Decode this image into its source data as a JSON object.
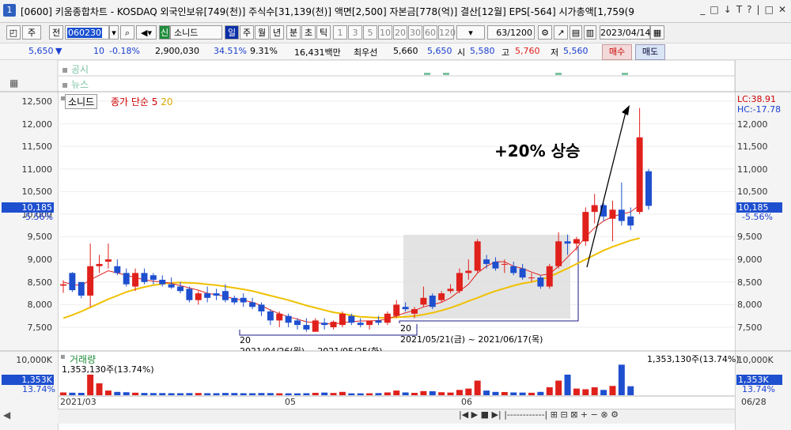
{
  "window": {
    "icon_label": "1",
    "title": "[0600] 키움종합차트 - KOSDAQ 외국인보유[749(천)] 주식수[31,139(천)] 액면[2,500] 자본금[778(억)] 결산[12월] EPS[-564] 시가총액[1,759(9",
    "controls": [
      "_",
      "□",
      "↓",
      "T",
      "?",
      "|",
      "□",
      "✕"
    ]
  },
  "toolbar": {
    "period_week": "주",
    "prev": "전",
    "code": "060230",
    "credit_tag": "신",
    "stock_name": "소니드",
    "periods": [
      "일",
      "주",
      "월",
      "년",
      "분",
      "초",
      "틱"
    ],
    "intervals": [
      "1",
      "3",
      "5",
      "10",
      "20",
      "30",
      "60",
      "120"
    ],
    "count": "63",
    "count_max": "/1200",
    "date": "2023/04/14"
  },
  "quote": {
    "price": "5,650",
    "change_sign": "▼",
    "change": "10",
    "change_pct": "-0.18%",
    "volume": "2,900,030",
    "ratio1": "34.51%",
    "ratio2": "9.31%",
    "amount": "16,431백만",
    "best_label": "최우선",
    "best_ask": "5,660",
    "best_bid": "5,650",
    "open_label": "시",
    "open": "5,580",
    "high_label": "고",
    "high": "5,760",
    "low_label": "저",
    "low": "5,560",
    "buy": "매수",
    "sell": "매도"
  },
  "panels": {
    "disclosure": "공시",
    "news": "뉴스"
  },
  "legend": {
    "name": "소니드",
    "ma_label": "종가 단순 5",
    "ma20": "20"
  },
  "annotation": {
    "text": "+20% 상승",
    "box_label1": "20",
    "box_range1": "2021/04/26(월) ~ 2021/05/25(화)",
    "box_label2": "20",
    "box_range2": "2021/05/21(금) ~ 2021/06/17(목)"
  },
  "price_axis": {
    "ticks": [
      "12,500",
      "12,000",
      "11,500",
      "11,000",
      "10,500",
      "10,000",
      "9,500",
      "9,000",
      "8,500",
      "8,000",
      "7,500"
    ],
    "current_price": "10,185",
    "current_change": "-5.56%",
    "lc": "LC:38.91",
    "hc": "HC:-17.78"
  },
  "volume_panel": {
    "label": "거래량",
    "info": "1,353,130주(13.74%)",
    "info_right": "1,353,130주(13.74%)",
    "axis_top": "10,000K",
    "current": "1,353K",
    "current_pct": "13.74%"
  },
  "x_axis": {
    "labels": [
      "2021/03",
      "05",
      "06",
      "06/28"
    ]
  },
  "colors": {
    "up": "#e0201b",
    "down": "#1e4fcf",
    "ma5": "#e0201b",
    "ma20": "#f0c000"
  },
  "chart_data": {
    "type": "candlestick",
    "title": "",
    "xlabel": "",
    "ylabel": "",
    "ylim": [
      7200,
      12700
    ],
    "candles": [
      {
        "o": 8420,
        "h": 8540,
        "l": 8260,
        "c": 8450
      },
      {
        "o": 8700,
        "h": 8720,
        "l": 8280,
        "c": 8320
      },
      {
        "o": 8500,
        "h": 8500,
        "l": 8140,
        "c": 8200
      },
      {
        "o": 8200,
        "h": 9350,
        "l": 7950,
        "c": 8850
      },
      {
        "o": 8850,
        "h": 9100,
        "l": 8700,
        "c": 8900
      },
      {
        "o": 8950,
        "h": 9350,
        "l": 8800,
        "c": 9000
      },
      {
        "o": 8850,
        "h": 9000,
        "l": 8650,
        "c": 8700
      },
      {
        "o": 8700,
        "h": 8800,
        "l": 8400,
        "c": 8450
      },
      {
        "o": 8400,
        "h": 8800,
        "l": 8300,
        "c": 8700
      },
      {
        "o": 8700,
        "h": 8800,
        "l": 8450,
        "c": 8500
      },
      {
        "o": 8650,
        "h": 8700,
        "l": 8450,
        "c": 8550
      },
      {
        "o": 8550,
        "h": 8650,
        "l": 8400,
        "c": 8450
      },
      {
        "o": 8450,
        "h": 8600,
        "l": 8350,
        "c": 8380
      },
      {
        "o": 8400,
        "h": 8500,
        "l": 8250,
        "c": 8300
      },
      {
        "o": 8350,
        "h": 8400,
        "l": 8050,
        "c": 8100
      },
      {
        "o": 8100,
        "h": 8300,
        "l": 8000,
        "c": 8250
      },
      {
        "o": 8250,
        "h": 8400,
        "l": 8050,
        "c": 8150
      },
      {
        "o": 8250,
        "h": 8350,
        "l": 8100,
        "c": 8200
      },
      {
        "o": 8300,
        "h": 8450,
        "l": 8050,
        "c": 8100
      },
      {
        "o": 8150,
        "h": 8200,
        "l": 8000,
        "c": 8050
      },
      {
        "o": 8150,
        "h": 8250,
        "l": 7950,
        "c": 8050
      },
      {
        "o": 8050,
        "h": 8150,
        "l": 7900,
        "c": 7950
      },
      {
        "o": 8000,
        "h": 8050,
        "l": 7750,
        "c": 7850
      },
      {
        "o": 7850,
        "h": 7900,
        "l": 7550,
        "c": 7650
      },
      {
        "o": 7650,
        "h": 7850,
        "l": 7500,
        "c": 7800
      },
      {
        "o": 7750,
        "h": 7800,
        "l": 7500,
        "c": 7600
      },
      {
        "o": 7650,
        "h": 7700,
        "l": 7450,
        "c": 7550
      },
      {
        "o": 7550,
        "h": 7700,
        "l": 7400,
        "c": 7450
      },
      {
        "o": 7400,
        "h": 7700,
        "l": 7400,
        "c": 7650
      },
      {
        "o": 7600,
        "h": 7700,
        "l": 7450,
        "c": 7550
      },
      {
        "o": 7500,
        "h": 7650,
        "l": 7450,
        "c": 7620
      },
      {
        "o": 7550,
        "h": 7850,
        "l": 7500,
        "c": 7800
      },
      {
        "o": 7750,
        "h": 7800,
        "l": 7550,
        "c": 7600
      },
      {
        "o": 7600,
        "h": 7700,
        "l": 7500,
        "c": 7550
      },
      {
        "o": 7550,
        "h": 7650,
        "l": 7450,
        "c": 7650
      },
      {
        "o": 7650,
        "h": 7750,
        "l": 7550,
        "c": 7600
      },
      {
        "o": 7600,
        "h": 7850,
        "l": 7550,
        "c": 7800
      },
      {
        "o": 7750,
        "h": 8100,
        "l": 7700,
        "c": 8000
      },
      {
        "o": 7950,
        "h": 8050,
        "l": 7850,
        "c": 7900
      },
      {
        "o": 7800,
        "h": 7950,
        "l": 7700,
        "c": 7900
      },
      {
        "o": 8000,
        "h": 8400,
        "l": 7950,
        "c": 8150
      },
      {
        "o": 8200,
        "h": 8250,
        "l": 7900,
        "c": 7950
      },
      {
        "o": 8100,
        "h": 8300,
        "l": 8050,
        "c": 8250
      },
      {
        "o": 8300,
        "h": 8450,
        "l": 8250,
        "c": 8350
      },
      {
        "o": 8300,
        "h": 8800,
        "l": 8250,
        "c": 8700
      },
      {
        "o": 8700,
        "h": 9000,
        "l": 8550,
        "c": 8750
      },
      {
        "o": 8750,
        "h": 9450,
        "l": 8700,
        "c": 9400
      },
      {
        "o": 9000,
        "h": 9100,
        "l": 8800,
        "c": 8900
      },
      {
        "o": 8950,
        "h": 9050,
        "l": 8750,
        "c": 8800
      },
      {
        "o": 8900,
        "h": 9000,
        "l": 8700,
        "c": 8900
      },
      {
        "o": 8850,
        "h": 8950,
        "l": 8650,
        "c": 8700
      },
      {
        "o": 8800,
        "h": 8900,
        "l": 8550,
        "c": 8600
      },
      {
        "o": 8600,
        "h": 8700,
        "l": 8500,
        "c": 8600
      },
      {
        "o": 8600,
        "h": 8650,
        "l": 8350,
        "c": 8400
      },
      {
        "o": 8400,
        "h": 8900,
        "l": 8350,
        "c": 8850
      },
      {
        "o": 8850,
        "h": 9600,
        "l": 8800,
        "c": 9400
      },
      {
        "o": 9400,
        "h": 9550,
        "l": 9100,
        "c": 9350
      },
      {
        "o": 9350,
        "h": 9500,
        "l": 9200,
        "c": 9450
      },
      {
        "o": 9400,
        "h": 10150,
        "l": 9300,
        "c": 10050
      },
      {
        "o": 10050,
        "h": 10450,
        "l": 9800,
        "c": 10200
      },
      {
        "o": 10200,
        "h": 10250,
        "l": 9850,
        "c": 9950
      },
      {
        "o": 9900,
        "h": 10300,
        "l": 9400,
        "c": 10100
      },
      {
        "o": 10100,
        "h": 10700,
        "l": 9750,
        "c": 9850
      },
      {
        "o": 9950,
        "h": 10150,
        "l": 9650,
        "c": 9750
      },
      {
        "o": 10050,
        "h": 12350,
        "l": 10000,
        "c": 11700
      },
      {
        "o": 10950,
        "h": 11000,
        "l": 10100,
        "c": 10185
      }
    ],
    "volume": [
      420,
      380,
      360,
      3100,
      1800,
      700,
      500,
      450,
      380,
      340,
      320,
      320,
      300,
      300,
      320,
      330,
      300,
      300,
      340,
      330,
      300,
      300,
      330,
      320,
      290,
      280,
      280,
      300,
      360,
      400,
      340,
      500,
      280,
      280,
      290,
      320,
      420,
      700,
      420,
      360,
      620,
      600,
      450,
      400,
      800,
      1000,
      2200,
      700,
      500,
      480,
      420,
      400,
      370,
      500,
      1200,
      2200,
      3100,
      1000,
      900,
      1200,
      800,
      1400,
      4600,
      1353
    ],
    "ma5": [
      8500,
      8450,
      8420,
      8550,
      8650,
      8750,
      8700,
      8650,
      8600,
      8550,
      8520,
      8500,
      8470,
      8420,
      8370,
      8320,
      8250,
      8220,
      8180,
      8130,
      8100,
      8050,
      7980,
      7880,
      7800,
      7730,
      7680,
      7620,
      7600,
      7580,
      7570,
      7600,
      7620,
      7640,
      7640,
      7650,
      7680,
      7750,
      7820,
      7870,
      7950,
      8000,
      8050,
      8150,
      8300,
      8450,
      8700,
      8850,
      8950,
      8950,
      8850,
      8800,
      8720,
      8650,
      8680,
      8850,
      9050,
      9250,
      9500,
      9700,
      9850,
      9950,
      10000,
      10050,
      10200
    ],
    "ma20": [
      7700,
      7770,
      7850,
      7940,
      8030,
      8120,
      8200,
      8280,
      8340,
      8390,
      8430,
      8460,
      8480,
      8490,
      8480,
      8470,
      8450,
      8430,
      8400,
      8370,
      8340,
      8300,
      8250,
      8200,
      8150,
      8100,
      8040,
      7980,
      7930,
      7880,
      7830,
      7800,
      7760,
      7730,
      7720,
      7710,
      7710,
      7720,
      7730,
      7750,
      7780,
      7820,
      7870,
      7930,
      8000,
      8080,
      8150,
      8230,
      8300,
      8360,
      8420,
      8470,
      8500,
      8550,
      8620,
      8710,
      8800,
      8900,
      9000,
      9100,
      9200,
      9280,
      9350,
      9420,
      9470
    ]
  }
}
